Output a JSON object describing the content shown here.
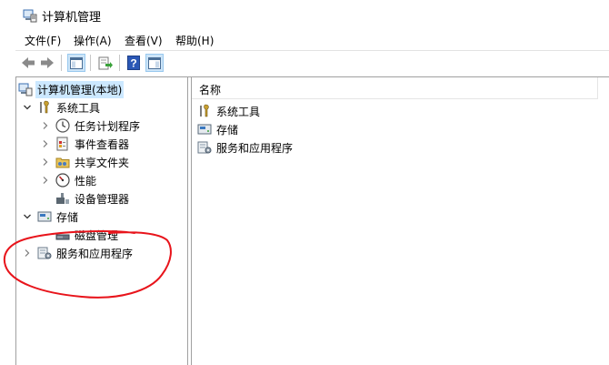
{
  "window": {
    "title": "计算机管理",
    "icon": "computer-management-icon"
  },
  "menu": [
    {
      "label": "文件(F)"
    },
    {
      "label": "操作(A)"
    },
    {
      "label": "查看(V)"
    },
    {
      "label": "帮助(H)"
    }
  ],
  "toolbar": {
    "buttons": [
      "back-arrow-icon",
      "forward-arrow-icon",
      "show-hide-console-tree-icon",
      "export-list-icon",
      "help-icon",
      "show-hide-action-pane-icon"
    ]
  },
  "tree": {
    "root": {
      "label": "计算机管理(本地)",
      "icon": "computer-management-icon",
      "selected": true
    },
    "system_tools": {
      "label": "系统工具",
      "icon": "tools-icon",
      "expanded": true
    },
    "task_scheduler": {
      "label": "任务计划程序",
      "icon": "clock-icon"
    },
    "event_viewer": {
      "label": "事件查看器",
      "icon": "event-viewer-icon"
    },
    "shared_folders": {
      "label": "共享文件夹",
      "icon": "shared-folder-icon"
    },
    "performance": {
      "label": "性能",
      "icon": "performance-gauge-icon"
    },
    "device_manager": {
      "label": "设备管理器",
      "icon": "device-manager-icon"
    },
    "storage": {
      "label": "存储",
      "icon": "storage-icon",
      "expanded": true
    },
    "disk_management": {
      "label": "磁盘管理",
      "icon": "disk-icon"
    },
    "services_apps": {
      "label": "服务和应用程序",
      "icon": "services-icon"
    }
  },
  "list": {
    "column_header": "名称",
    "items": [
      {
        "label": "系统工具",
        "icon": "tools-icon"
      },
      {
        "label": "存储",
        "icon": "storage-icon"
      },
      {
        "label": "服务和应用程序",
        "icon": "services-icon"
      }
    ]
  },
  "colors": {
    "selection": "#cce8ff",
    "annotation": "#e8141b",
    "border": "#a0a0a0"
  }
}
